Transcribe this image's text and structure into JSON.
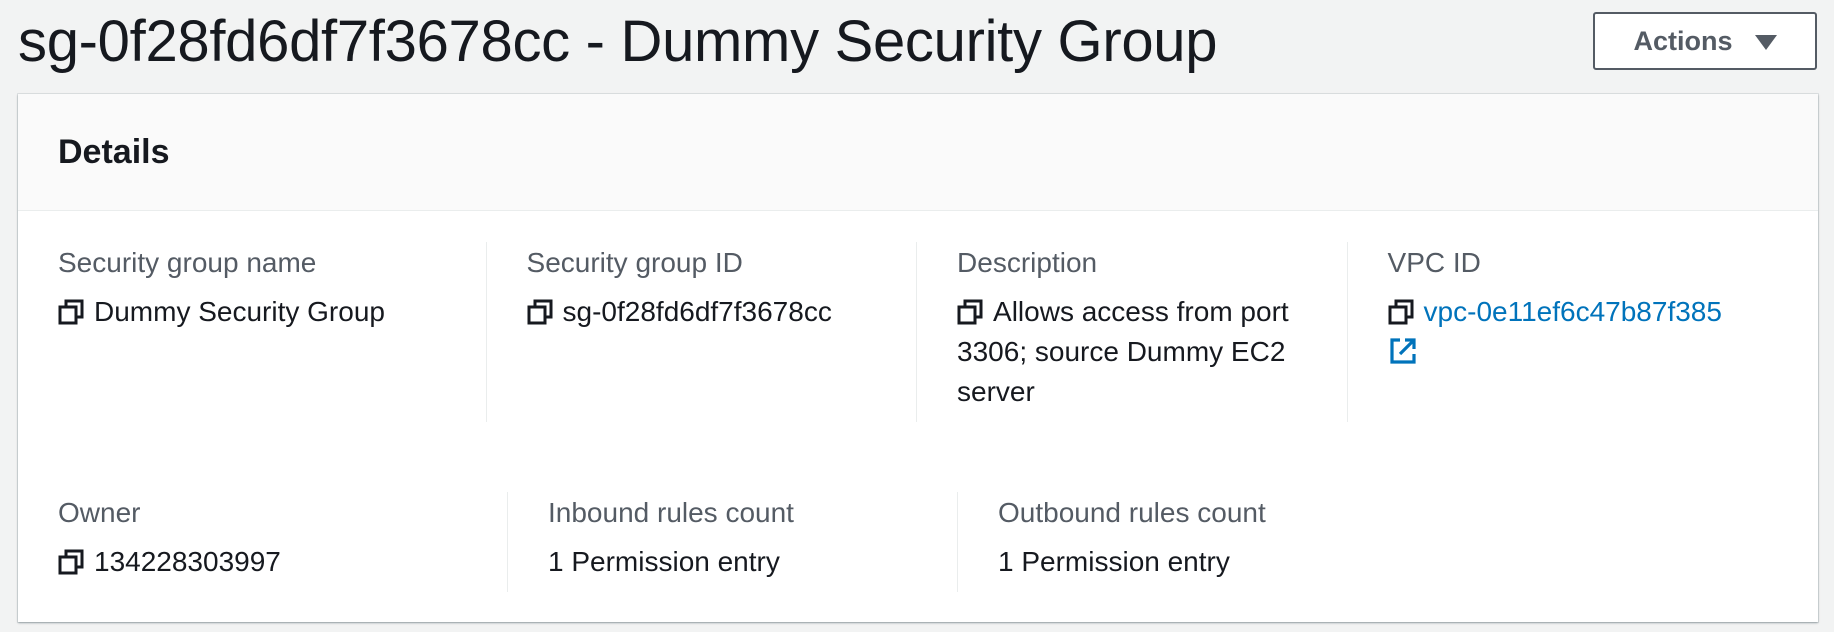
{
  "header": {
    "title": "sg-0f28fd6df7f3678cc - Dummy Security Group",
    "actions_label": "Actions"
  },
  "details": {
    "title": "Details",
    "fields": {
      "sg_name": {
        "label": "Security group name",
        "value": "Dummy Security Group"
      },
      "sg_id": {
        "label": "Security group ID",
        "value": "sg-0f28fd6df7f3678cc"
      },
      "description": {
        "label": "Description",
        "value": "Allows access from port 3306; source Dummy EC2 server"
      },
      "vpc_id": {
        "label": "VPC ID",
        "value": "vpc-0e11ef6c47b87f385"
      },
      "owner": {
        "label": "Owner",
        "value": "134228303997"
      },
      "inbound": {
        "label": "Inbound rules count",
        "value": "1 Permission entry"
      },
      "outbound": {
        "label": "Outbound rules count",
        "value": "1 Permission entry"
      }
    }
  },
  "icons": {
    "copy": "copy-icon",
    "external_link": "external-link-icon",
    "dropdown": "caret-down-icon"
  },
  "colors": {
    "link": "#0073bb",
    "label": "#545b64",
    "text": "#16191f",
    "background": "#f2f3f3"
  }
}
